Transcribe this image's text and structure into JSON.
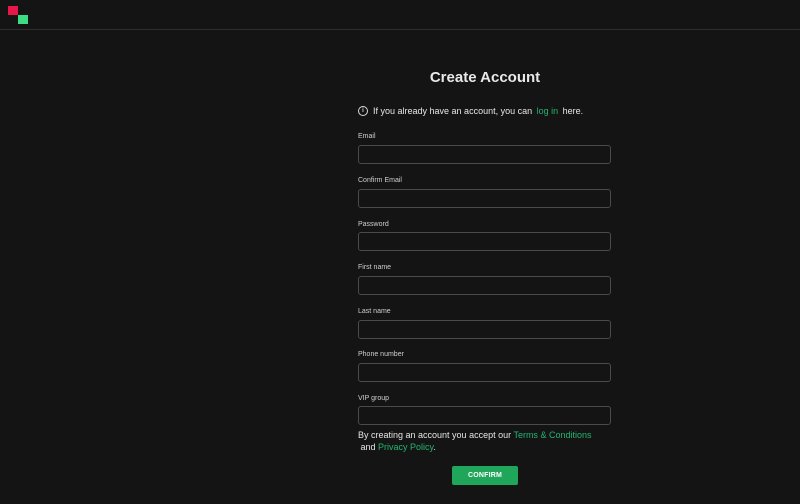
{
  "colors": {
    "background": "#141414",
    "accent": "#22b573",
    "button": "#1fa65a",
    "logo_red": "#e8174a",
    "logo_green": "#3ddc84"
  },
  "header": {
    "logo_icon": "logo-icon"
  },
  "form": {
    "title": "Create Account",
    "info": {
      "icon": "info-icon",
      "prefix": "If you already have an account, you can ",
      "link": "log in",
      "suffix": " here."
    },
    "fields": [
      {
        "label": "Email",
        "value": "",
        "placeholder": ""
      },
      {
        "label": "Confirm Email",
        "value": "",
        "placeholder": ""
      },
      {
        "label": "Password",
        "value": "",
        "placeholder": ""
      },
      {
        "label": "First name",
        "value": "",
        "placeholder": ""
      },
      {
        "label": "Last name",
        "value": "",
        "placeholder": ""
      },
      {
        "label": "Phone number",
        "value": "",
        "placeholder": ""
      },
      {
        "label": "VIP group",
        "value": "",
        "placeholder": ""
      }
    ],
    "terms": {
      "prefix": "By creating an account you accept our ",
      "terms_link": "Terms & Conditions",
      "middle": " and ",
      "privacy_link": "Privacy Policy",
      "suffix": "."
    },
    "confirm_label": "CONFIRM"
  }
}
